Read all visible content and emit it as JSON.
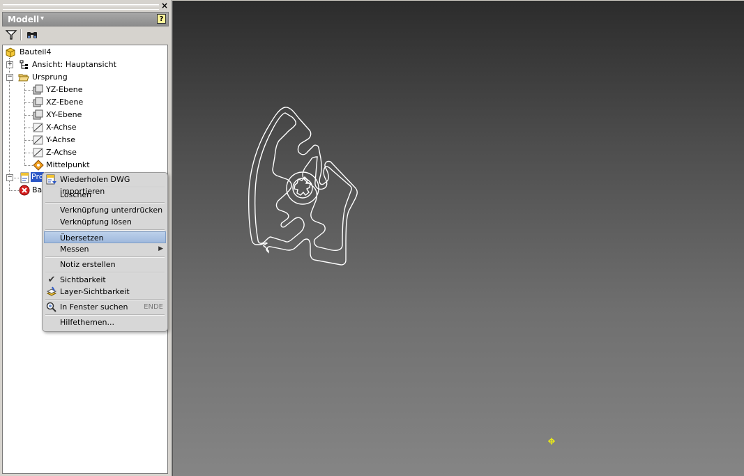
{
  "panel": {
    "close_glyph": "×",
    "title": "Modell",
    "title_dropdown_glyph": "▾",
    "help_glyph": "?",
    "toolbar": {
      "filter_icon": "filter-icon",
      "find_icon": "binoculars-icon"
    }
  },
  "tree": {
    "root": {
      "label": "Bauteil4",
      "icon": "part-cube-icon"
    },
    "items": [
      {
        "label": "Ansicht: Hauptansicht",
        "icon": "view-rep-icon",
        "expander": "+"
      },
      {
        "label": "Ursprung",
        "icon": "folder-open-icon",
        "expander": "−"
      },
      {
        "label": "YZ-Ebene",
        "icon": "plane-icon"
      },
      {
        "label": "XZ-Ebene",
        "icon": "plane-icon"
      },
      {
        "label": "XY-Ebene",
        "icon": "plane-icon"
      },
      {
        "label": "X-Achse",
        "icon": "axis-icon"
      },
      {
        "label": "Y-Achse",
        "icon": "axis-icon"
      },
      {
        "label": "Z-Achse",
        "icon": "axis-icon"
      },
      {
        "label": "Mittelpunkt",
        "icon": "center-point-icon"
      },
      {
        "label": "Pro",
        "icon": "dwg-import-icon",
        "expander": "−",
        "selected": true
      },
      {
        "label": "Bau",
        "icon": "error-icon"
      }
    ]
  },
  "context_menu": {
    "items": [
      {
        "label": "Wiederholen DWG importieren",
        "icon": "import-dwg-icon"
      },
      {
        "label": "Löschen"
      },
      {
        "label": "Verknüpfung unterdrücken"
      },
      {
        "label": "Verknüpfung lösen"
      },
      {
        "label": "Übersetzen",
        "highlighted": true
      },
      {
        "label": "Messen",
        "submenu": true
      },
      {
        "label": "Notiz erstellen"
      },
      {
        "label": "Sichtbarkeit",
        "checked": true
      },
      {
        "label": "Layer-Sichtbarkeit",
        "icon": "layer-visibility-icon"
      },
      {
        "label": "In Fenster suchen",
        "icon": "find-in-window-icon",
        "shortcut": "ENDE"
      },
      {
        "label": "Hilfethemen..."
      }
    ],
    "submenu_glyph": "▶",
    "check_glyph": "✔"
  },
  "viewport": {
    "accent": "#ffffff",
    "marker_color": "#ffff00"
  }
}
